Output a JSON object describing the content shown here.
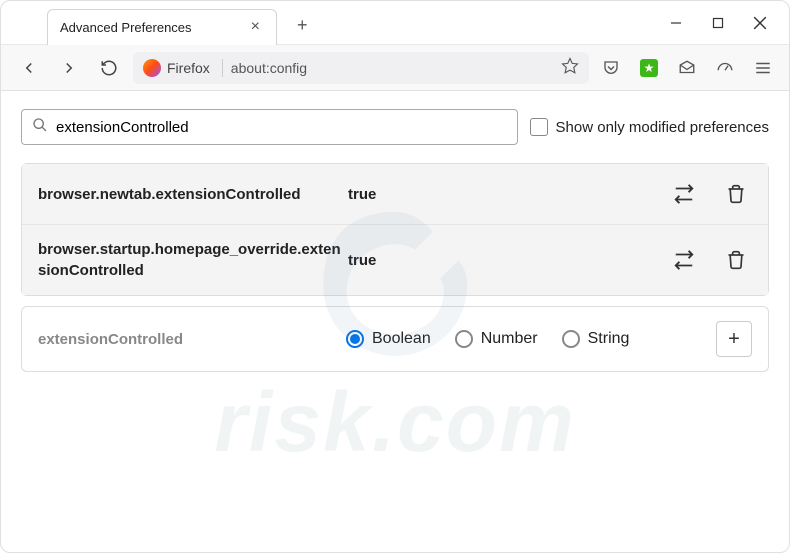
{
  "tab": {
    "title": "Advanced Preferences"
  },
  "url_bar": {
    "brand": "Firefox",
    "url": "about:config"
  },
  "search": {
    "value": "extensionControlled",
    "checkbox_label": "Show only modified preferences"
  },
  "results": [
    {
      "name": "browser.newtab.extensionControlled",
      "value": "true"
    },
    {
      "name": "browser.startup.homepage_override.extensionControlled",
      "value": "true"
    }
  ],
  "new_pref": {
    "name": "extensionControlled",
    "types": [
      "Boolean",
      "Number",
      "String"
    ],
    "selected": "Boolean"
  },
  "watermark": {
    "text": "risk.com"
  }
}
